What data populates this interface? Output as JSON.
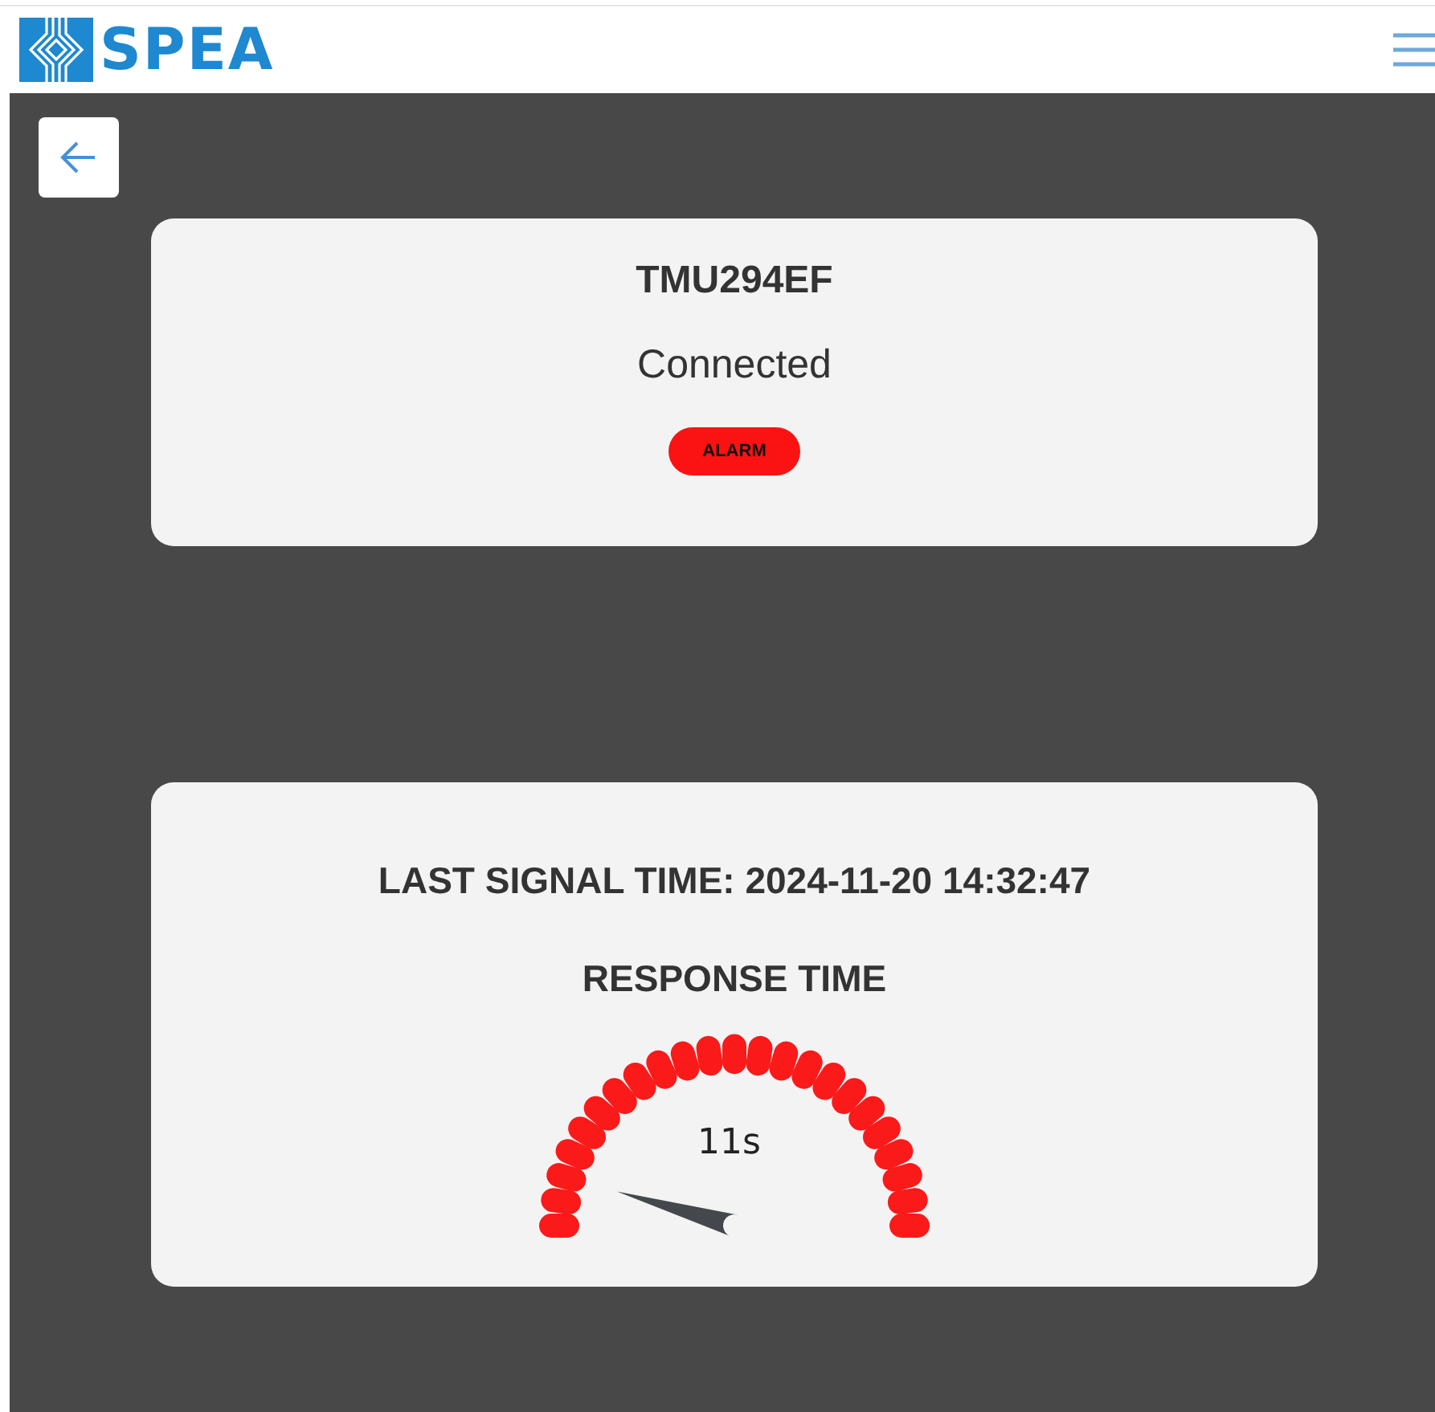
{
  "header": {
    "logo_text": "SPEA"
  },
  "device": {
    "name": "TMU294EF",
    "connection": "Connected",
    "status": {
      "label": "ALARM",
      "kind": "alarm"
    }
  },
  "signal": {
    "last_signal": "LAST SIGNAL TIME: 2024-11-20 14:32:47",
    "gauge_title": "RESPONSE TIME",
    "reading": "11s"
  }
}
